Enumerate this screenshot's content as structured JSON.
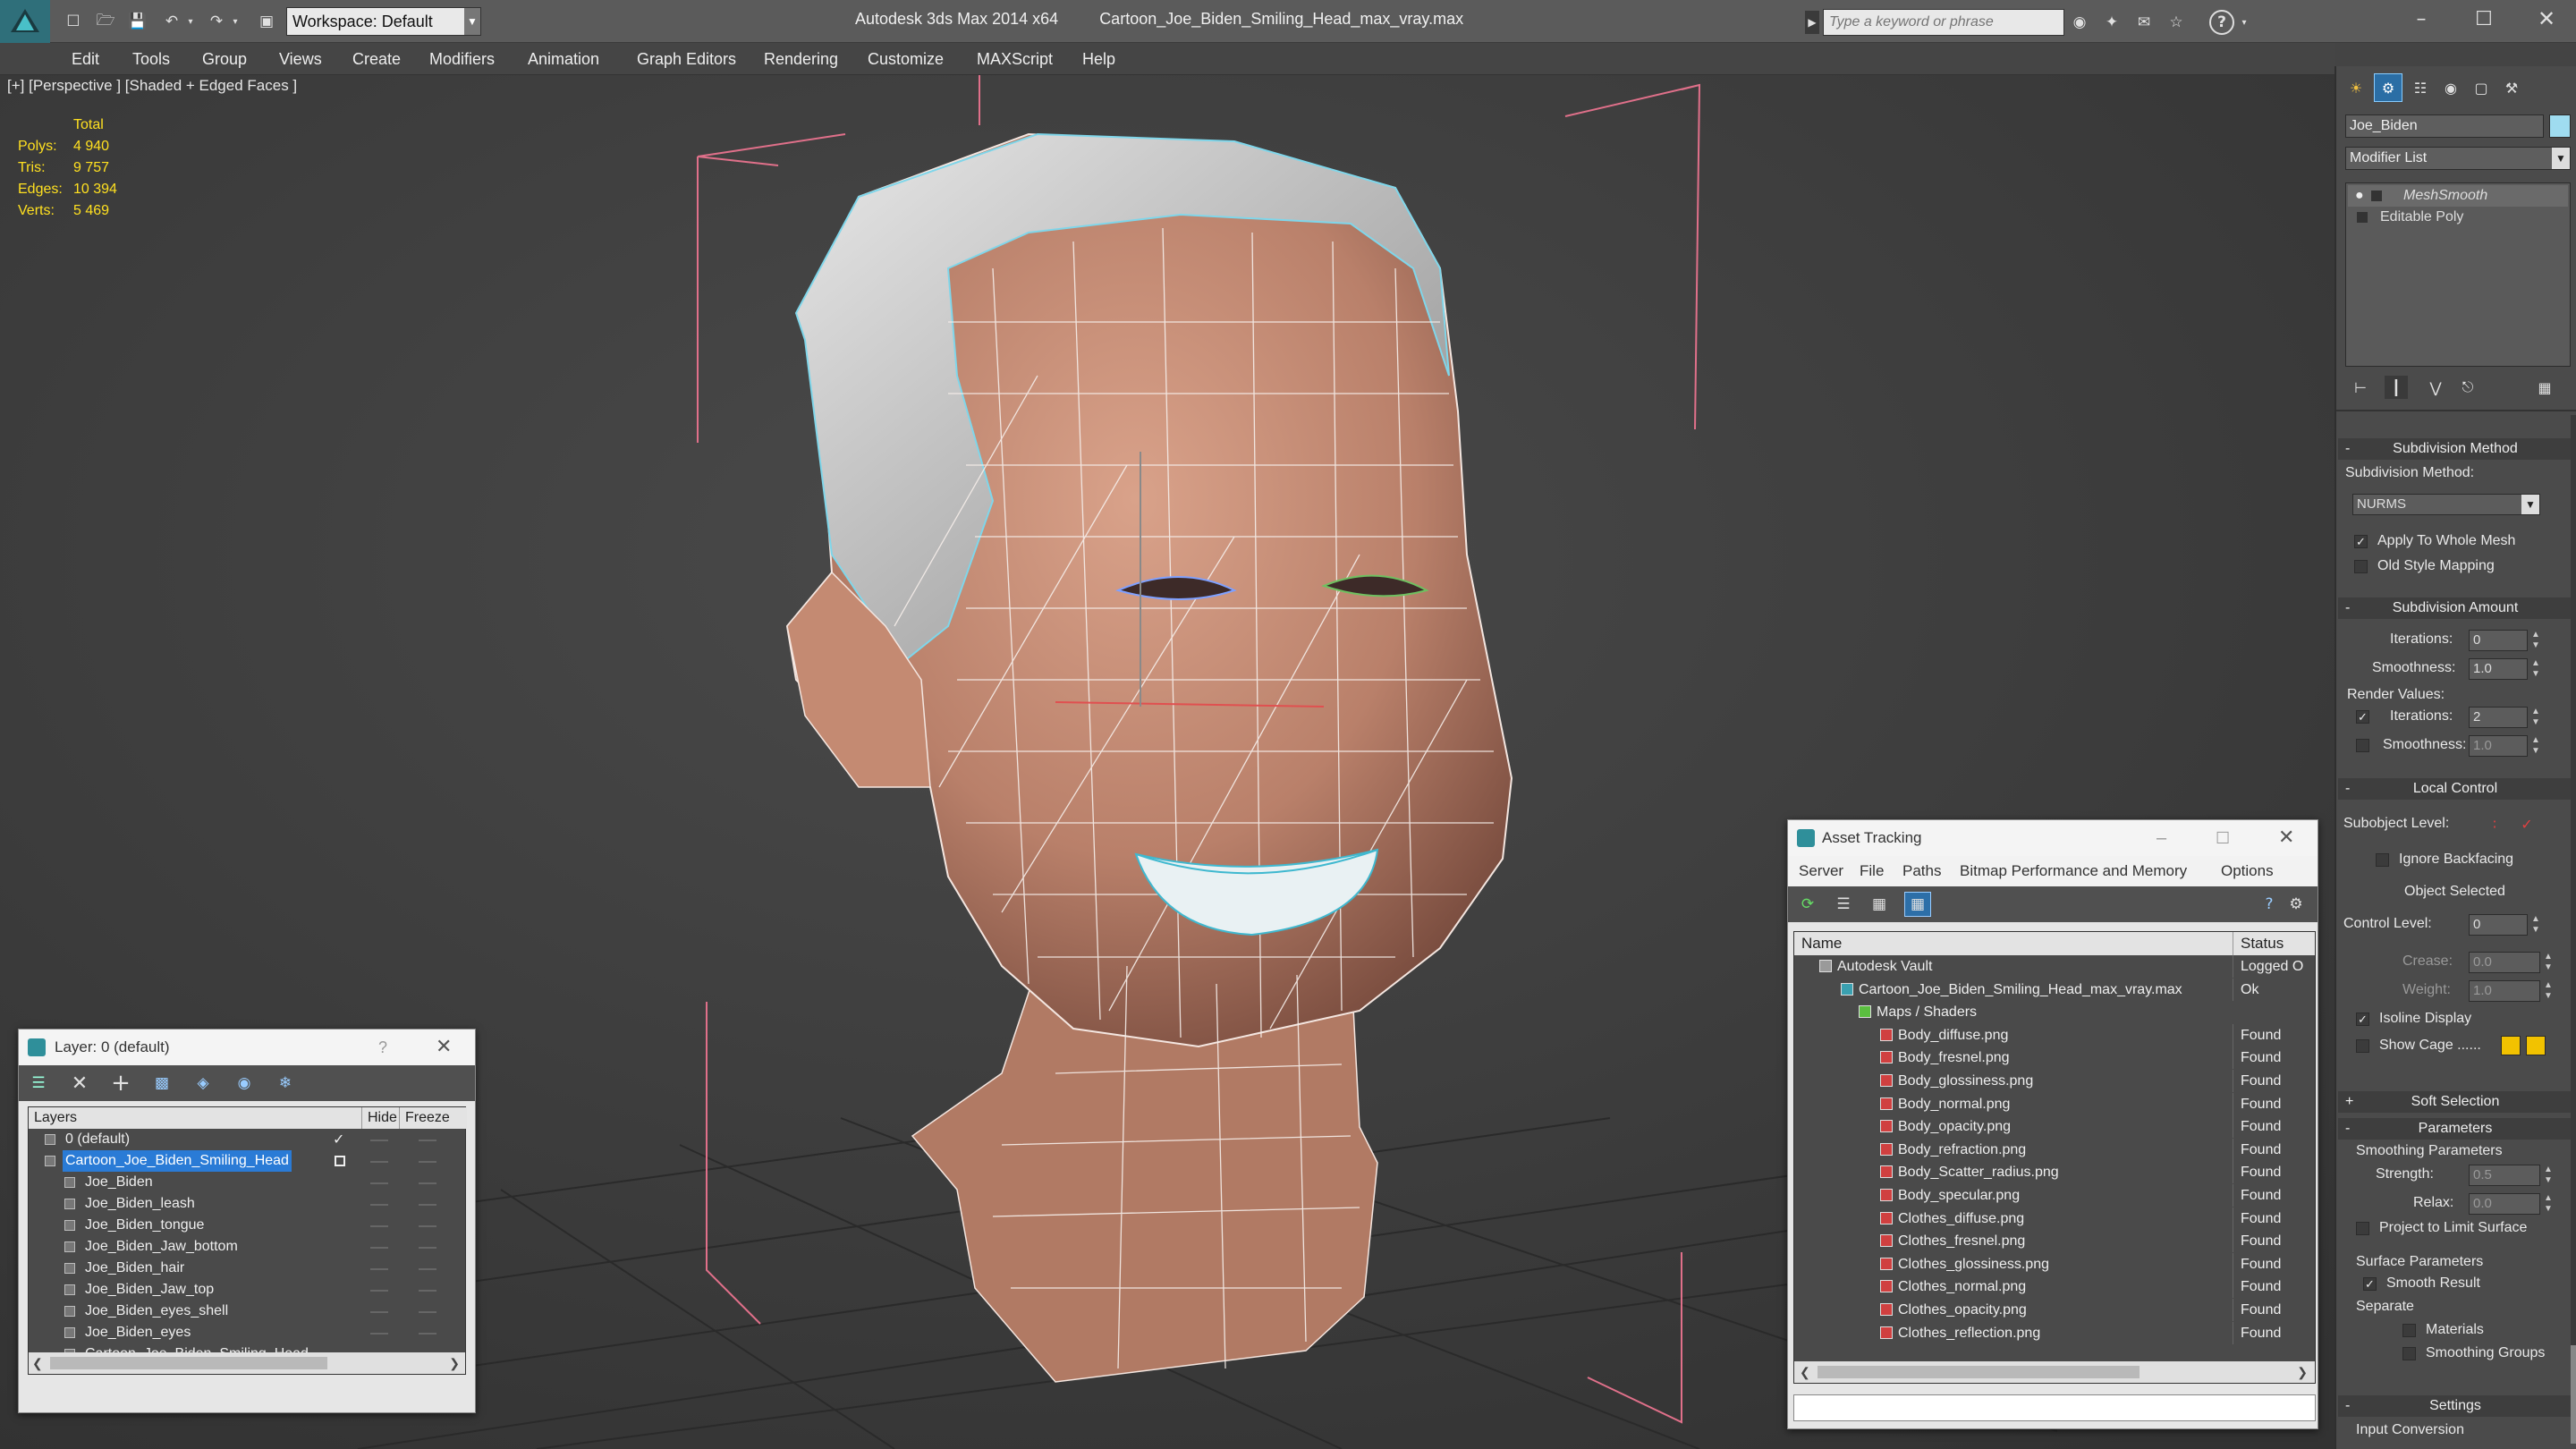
{
  "title_bar": {
    "app_title": "Autodesk 3ds Max  2014 x64",
    "file_title": "Cartoon_Joe_Biden_Smiling_Head_max_vray.max",
    "workspace_label": "Workspace: Default",
    "search_placeholder": "Type a keyword or phrase"
  },
  "menus": [
    "Edit",
    "Tools",
    "Group",
    "Views",
    "Create",
    "Modifiers",
    "Animation",
    "Graph Editors",
    "Rendering",
    "Customize",
    "MAXScript",
    "Help"
  ],
  "viewport": {
    "label": "[+] [Perspective ] [Shaded + Edged Faces ]",
    "stats_header": "Total",
    "stats": [
      {
        "label": "Polys:",
        "value": "4 940"
      },
      {
        "label": "Tris:",
        "value": "9 757"
      },
      {
        "label": "Edges:",
        "value": "10 394"
      },
      {
        "label": "Verts:",
        "value": "5 469"
      }
    ]
  },
  "command_panel": {
    "object_name": "Joe_Biden",
    "object_color": "#9fdcf0",
    "modifier_list_label": "Modifier List",
    "stack": [
      "MeshSmooth",
      "Editable Poly"
    ],
    "subdivision_method": {
      "header": "Subdivision Method",
      "label": "Subdivision Method:",
      "value": "NURMS",
      "apply_whole_mesh": "Apply To Whole Mesh",
      "old_style_mapping": "Old Style Mapping"
    },
    "subdivision_amount": {
      "header": "Subdivision Amount",
      "iterations_label": "Iterations:",
      "iterations": "0",
      "smoothness_label": "Smoothness:",
      "smoothness": "1.0",
      "render_values": "Render Values:",
      "render_iterations_label": "Iterations:",
      "render_iterations": "2",
      "render_smoothness_label": "Smoothness:",
      "render_smoothness": "1.0"
    },
    "local_control": {
      "header": "Local Control",
      "subobject_level": "Subobject Level:",
      "ignore_backfacing": "Ignore Backfacing",
      "object_selected": "Object Selected",
      "control_level_label": "Control Level:",
      "control_level": "0",
      "crease_label": "Crease:",
      "crease": "0.0",
      "weight_label": "Weight:",
      "weight": "1.0",
      "isoline_display": "Isoline Display",
      "show_cage": "Show Cage ......",
      "cage_color_1": "#f2c200",
      "cage_color_2": "#f2c200"
    },
    "soft_selection": {
      "header": "Soft Selection"
    },
    "parameters": {
      "header": "Parameters",
      "smoothing_parameters": "Smoothing Parameters",
      "strength_label": "Strength:",
      "strength": "0.5",
      "relax_label": "Relax:",
      "relax": "0.0",
      "project_limit": "Project to Limit Surface",
      "surface_parameters": "Surface Parameters",
      "smooth_result": "Smooth Result",
      "separate": "Separate",
      "materials": "Materials",
      "smoothing_groups": "Smoothing Groups"
    },
    "settings": {
      "header": "Settings",
      "input_conversion": "Input Conversion"
    }
  },
  "layer_window": {
    "title": "Layer: 0 (default)",
    "help": "?",
    "col_layers": "Layers",
    "col_hide": "Hide",
    "col_freeze": "Freeze",
    "rows": [
      {
        "name": "0 (default)",
        "level": 0,
        "selected": false
      },
      {
        "name": "Cartoon_Joe_Biden_Smiling_Head",
        "level": 0,
        "selected": true
      },
      {
        "name": "Joe_Biden",
        "level": 1,
        "selected": false
      },
      {
        "name": "Joe_Biden_leash",
        "level": 1,
        "selected": false
      },
      {
        "name": "Joe_Biden_tongue",
        "level": 1,
        "selected": false
      },
      {
        "name": "Joe_Biden_Jaw_bottom",
        "level": 1,
        "selected": false
      },
      {
        "name": "Joe_Biden_hair",
        "level": 1,
        "selected": false
      },
      {
        "name": "Joe_Biden_Jaw_top",
        "level": 1,
        "selected": false
      },
      {
        "name": "Joe_Biden_eyes_shell",
        "level": 1,
        "selected": false
      },
      {
        "name": "Joe_Biden_eyes",
        "level": 1,
        "selected": false
      },
      {
        "name": "Cartoon_Joe_Biden_Smiling_Head",
        "level": 1,
        "selected": false
      }
    ]
  },
  "asset_tracking": {
    "title": "Asset Tracking",
    "menus": [
      "Server",
      "File",
      "Paths",
      "Bitmap Performance and Memory",
      "Options"
    ],
    "col_name": "Name",
    "col_status": "Status",
    "rows": [
      {
        "name": "Autodesk Vault",
        "status": "Logged O",
        "level": 0,
        "icon": "vault"
      },
      {
        "name": "Cartoon_Joe_Biden_Smiling_Head_max_vray.max",
        "status": "Ok",
        "level": 1,
        "icon": "max"
      },
      {
        "name": "Maps / Shaders",
        "status": "",
        "level": 2,
        "icon": "maps"
      },
      {
        "name": "Body_diffuse.png",
        "status": "Found",
        "level": 3,
        "icon": "png"
      },
      {
        "name": "Body_fresnel.png",
        "status": "Found",
        "level": 3,
        "icon": "png"
      },
      {
        "name": "Body_glossiness.png",
        "status": "Found",
        "level": 3,
        "icon": "png"
      },
      {
        "name": "Body_normal.png",
        "status": "Found",
        "level": 3,
        "icon": "png"
      },
      {
        "name": "Body_opacity.png",
        "status": "Found",
        "level": 3,
        "icon": "png"
      },
      {
        "name": "Body_refraction.png",
        "status": "Found",
        "level": 3,
        "icon": "png"
      },
      {
        "name": "Body_Scatter_radius.png",
        "status": "Found",
        "level": 3,
        "icon": "png"
      },
      {
        "name": "Body_specular.png",
        "status": "Found",
        "level": 3,
        "icon": "png"
      },
      {
        "name": "Clothes_diffuse.png",
        "status": "Found",
        "level": 3,
        "icon": "png"
      },
      {
        "name": "Clothes_fresnel.png",
        "status": "Found",
        "level": 3,
        "icon": "png"
      },
      {
        "name": "Clothes_glossiness.png",
        "status": "Found",
        "level": 3,
        "icon": "png"
      },
      {
        "name": "Clothes_normal.png",
        "status": "Found",
        "level": 3,
        "icon": "png"
      },
      {
        "name": "Clothes_opacity.png",
        "status": "Found",
        "level": 3,
        "icon": "png"
      },
      {
        "name": "Clothes_reflection.png",
        "status": "Found",
        "level": 3,
        "icon": "png"
      }
    ]
  }
}
